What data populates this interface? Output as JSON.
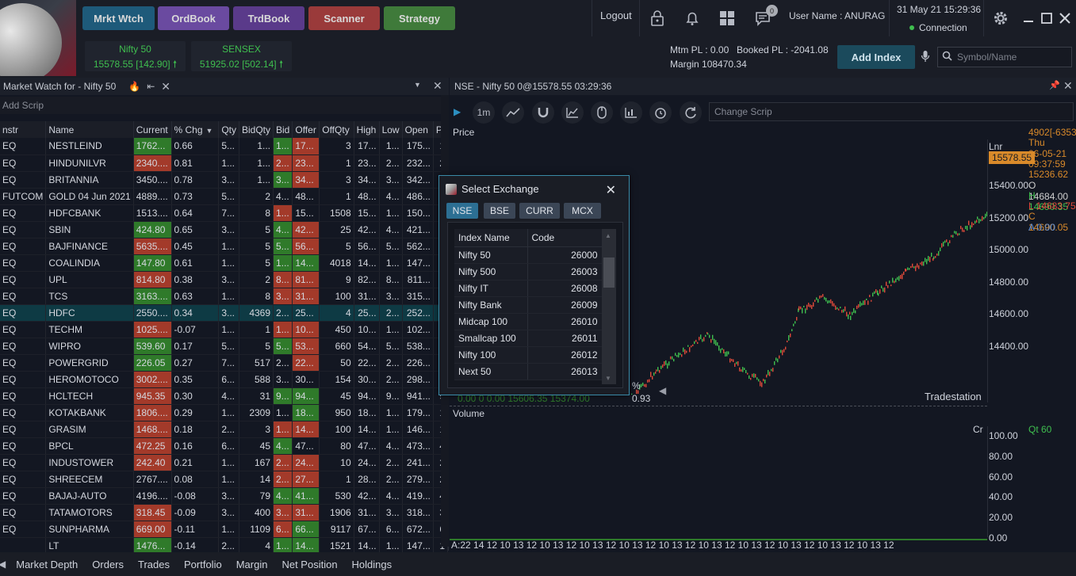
{
  "nav": {
    "buttons": [
      {
        "label": "Mrkt Wtch",
        "color": "#1e5a7a"
      },
      {
        "label": "OrdBook",
        "color": "#6a4aa0"
      },
      {
        "label": "TrdBook",
        "color": "#5a3a8a"
      },
      {
        "label": "Scanner",
        "color": "#9a3a3a"
      },
      {
        "label": "Strategy",
        "color": "#3f7a3a"
      }
    ]
  },
  "tickers": [
    {
      "name": "Nifty 50",
      "value": "15578.55 [142.90]"
    },
    {
      "name": "SENSEX",
      "value": "51925.02 [502.14]"
    }
  ],
  "header": {
    "logout": "Logout",
    "notification_count": "0",
    "user_name": "User Name : ANURAG",
    "datetime": "31 May 21 15:29:36",
    "connection": "Connection",
    "mtm": "Mtm PL : 0.00",
    "booked": "Booked PL : -2041.08",
    "margin": "Margin  108470.34",
    "add_index": "Add Index",
    "search_placeholder": "Symbol/Name"
  },
  "market_watch": {
    "title": "Market Watch for  -  Nifty 50",
    "add_scrip": "Add Scrip",
    "columns": [
      "nstr",
      "Name",
      "Current",
      "% Chg",
      "Qty",
      "BidQty",
      "Bid",
      "Offer",
      "OffQty",
      "High",
      "Low",
      "Open",
      "P"
    ],
    "rows": [
      [
        "EQ",
        "NESTLEIND",
        "1762...",
        "0.66",
        "5...",
        "1...",
        "1...",
        "17...",
        "3",
        "17...",
        "1...",
        "175...",
        "1",
        "up",
        "up",
        "dn"
      ],
      [
        "EQ",
        "HINDUNILVR",
        "2340....",
        "0.81",
        "1...",
        "1...",
        "2...",
        "23...",
        "1",
        "23...",
        "2...",
        "232...",
        "2",
        "dn",
        "dn",
        "dn"
      ],
      [
        "EQ",
        "BRITANNIA",
        "3450....",
        "0.78",
        "3...",
        "1...",
        "3...",
        "34...",
        "3",
        "34...",
        "3...",
        "342...",
        "3",
        "none",
        "up",
        "dn"
      ],
      [
        "FUTCOM",
        "GOLD 04 Jun 2021",
        "4889....",
        "0.73",
        "5...",
        "2",
        "4...",
        "48...",
        "1",
        "48...",
        "4...",
        "486...",
        "4",
        "none",
        "none",
        "none"
      ],
      [
        "EQ",
        "HDFCBANK",
        "1513....",
        "0.64",
        "7...",
        "8",
        "1...",
        "15...",
        "1508",
        "15...",
        "1...",
        "150...",
        "1",
        "none",
        "dn",
        "none"
      ],
      [
        "EQ",
        "SBIN",
        "424.80",
        "0.65",
        "3...",
        "5",
        "4...",
        "42...",
        "25",
        "42...",
        "4...",
        "421...",
        "4",
        "up",
        "up",
        "dn"
      ],
      [
        "EQ",
        "BAJFINANCE",
        "5635....",
        "0.45",
        "1...",
        "5",
        "5...",
        "56...",
        "5",
        "56...",
        "5...",
        "562...",
        "5",
        "dn",
        "up",
        "dn"
      ],
      [
        "EQ",
        "COALINDIA",
        "147.80",
        "0.61",
        "1...",
        "5",
        "1...",
        "14...",
        "4018",
        "14...",
        "1...",
        "147...",
        "1",
        "up",
        "up",
        "up"
      ],
      [
        "EQ",
        "UPL",
        "814.80",
        "0.38",
        "3...",
        "2",
        "8...",
        "81...",
        "9",
        "82...",
        "8...",
        "811...",
        "8",
        "dn",
        "dn",
        "dn"
      ],
      [
        "EQ",
        "TCS",
        "3163....",
        "0.63",
        "1...",
        "8",
        "3...",
        "31...",
        "100",
        "31...",
        "3...",
        "315...",
        "3",
        "up",
        "dn",
        "dn"
      ],
      [
        "EQ",
        "HDFC",
        "2550....",
        "0.34",
        "3...",
        "4369",
        "2...",
        "25...",
        "4",
        "25...",
        "2...",
        "252...",
        "2",
        "sel",
        "sel",
        "sel"
      ],
      [
        "EQ",
        "TECHM",
        "1025....",
        "-0.07",
        "1...",
        "1",
        "1...",
        "10...",
        "450",
        "10...",
        "1...",
        "102...",
        "1",
        "dn",
        "dn",
        "dn"
      ],
      [
        "EQ",
        "WIPRO",
        "539.60",
        "0.17",
        "5...",
        "5",
        "5...",
        "53...",
        "660",
        "54...",
        "5...",
        "538...",
        "5",
        "up",
        "up",
        "dn"
      ],
      [
        "EQ",
        "POWERGRID",
        "226.05",
        "0.27",
        "7...",
        "517",
        "2...",
        "22...",
        "50",
        "22...",
        "2...",
        "226...",
        "2",
        "up",
        "none",
        "dn"
      ],
      [
        "EQ",
        "HEROMOTOCO",
        "3002....",
        "0.35",
        "6...",
        "588",
        "3...",
        "30...",
        "154",
        "30...",
        "2...",
        "298...",
        "3",
        "dn",
        "none",
        "none"
      ],
      [
        "EQ",
        "HCLTECH",
        "945.35",
        "0.30",
        "4...",
        "31",
        "9...",
        "94...",
        "45",
        "94...",
        "9...",
        "941...",
        "9",
        "dn",
        "up",
        "up"
      ],
      [
        "EQ",
        "KOTAKBANK",
        "1806....",
        "0.29",
        "1...",
        "2309",
        "1...",
        "18...",
        "950",
        "18...",
        "1...",
        "179...",
        "1",
        "dn",
        "none",
        "up"
      ],
      [
        "EQ",
        "GRASIM",
        "1468....",
        "0.18",
        "2...",
        "3",
        "1...",
        "14...",
        "100",
        "14...",
        "1...",
        "146...",
        "1",
        "dn",
        "dn",
        "dn"
      ],
      [
        "EQ",
        "BPCL",
        "472.25",
        "0.16",
        "6...",
        "45",
        "4...",
        "47...",
        "80",
        "47...",
        "4...",
        "473...",
        "4",
        "dn",
        "up",
        "none"
      ],
      [
        "EQ",
        "INDUSTOWER",
        "242.40",
        "0.21",
        "1...",
        "167",
        "2...",
        "24...",
        "10",
        "24...",
        "2...",
        "241...",
        "2",
        "dn",
        "dn",
        "dn"
      ],
      [
        "EQ",
        "SHREECEM",
        "2767....",
        "0.08",
        "1...",
        "14",
        "2...",
        "27...",
        "1",
        "28...",
        "2...",
        "279...",
        "2",
        "none",
        "dn",
        "dn"
      ],
      [
        "EQ",
        "BAJAJ-AUTO",
        "4196....",
        "-0.08",
        "3...",
        "79",
        "4...",
        "41...",
        "530",
        "42...",
        "4...",
        "419...",
        "4",
        "none",
        "up",
        "up"
      ],
      [
        "EQ",
        "TATAMOTORS",
        "318.45",
        "-0.09",
        "3...",
        "400",
        "3...",
        "31...",
        "1906",
        "31...",
        "3...",
        "318...",
        "3",
        "dn",
        "dn",
        "dn"
      ],
      [
        "EQ",
        "SUNPHARMA",
        "669.00",
        "-0.11",
        "1...",
        "1109",
        "6...",
        "66...",
        "9117",
        "67...",
        "6...",
        "672...",
        "6",
        "dn",
        "dn",
        "up"
      ],
      [
        "",
        "LT",
        "1476...",
        "-0.14",
        "2...",
        "4",
        "1...",
        "14...",
        "1521",
        "14...",
        "1...",
        "147...",
        "1",
        "up",
        "up",
        "up"
      ]
    ]
  },
  "chart": {
    "title": "NSE - Nifty 50  0@15578.55 03:29:36",
    "interval": "1m",
    "change_scrip": "Change Scrip",
    "price_label": "Price",
    "volume_label": "Volume",
    "lnr": "Lnr",
    "cr": "Cr",
    "qt": "Qt 60",
    "tradestation": "Tradestation",
    "percent_label": "%",
    "percent_value": "0.93",
    "overlay_values": "0.00  0  0.00   15606.35   15374.00",
    "last_price": "15578.55",
    "price_ticks": [
      "15400.00",
      "15200.00",
      "15000.00",
      "14800.00",
      "14600.00",
      "14400.00"
    ],
    "volume_ticks": [
      "100.00",
      "80.00",
      "60.00",
      "40.00",
      "20.00",
      "0.00"
    ],
    "time_axis": "A:22   14  12  10  13  12  10  13  12  10  13  12  10  13  12  10  13  12  10  13  12  10  13  12  10  13  12  10  13  12  10  13  12",
    "ohlc": [
      {
        "text": "4902[-6353]",
        "color": "#d98a2a"
      },
      {
        "text": "Thu",
        "color": "#d98a2a"
      },
      {
        "text": "06-05-21",
        "color": "#d98a2a"
      },
      {
        "text": "09:37:59",
        "color": "#d98a2a"
      },
      {
        "text": "15236.62",
        "color": "#d98a2a"
      },
      {
        "text": "O 14684.00",
        "color": "#d0d0d0"
      },
      {
        "text": "H 14690.35",
        "color": "#3fbf4f"
      },
      {
        "text": "L 14683.75",
        "color": "#e04a3a"
      },
      {
        "text": "C 14690.05",
        "color": "#d98a2a"
      },
      {
        "text": "A 0.00",
        "color": "#5a8ad0"
      }
    ]
  },
  "dialog": {
    "title": "Select Exchange",
    "tabs": [
      "NSE",
      "BSE",
      "CURR",
      "MCX"
    ],
    "columns": [
      "Index Name",
      "Code"
    ],
    "rows": [
      [
        "Nifty 50",
        "26000"
      ],
      [
        "Nifty 500",
        "26003"
      ],
      [
        "Nifty IT",
        "26008"
      ],
      [
        "Nifty Bank",
        "26009"
      ],
      [
        "Midcap 100",
        "26010"
      ],
      [
        "Smallcap 100",
        "26011"
      ],
      [
        "Nifty 100",
        "26012"
      ],
      [
        "Next 50",
        "26013"
      ]
    ]
  },
  "bottom_tabs": [
    "Market Depth",
    "Orders",
    "Trades",
    "Portfolio",
    "Margin",
    "Net Position",
    "Holdings"
  ]
}
